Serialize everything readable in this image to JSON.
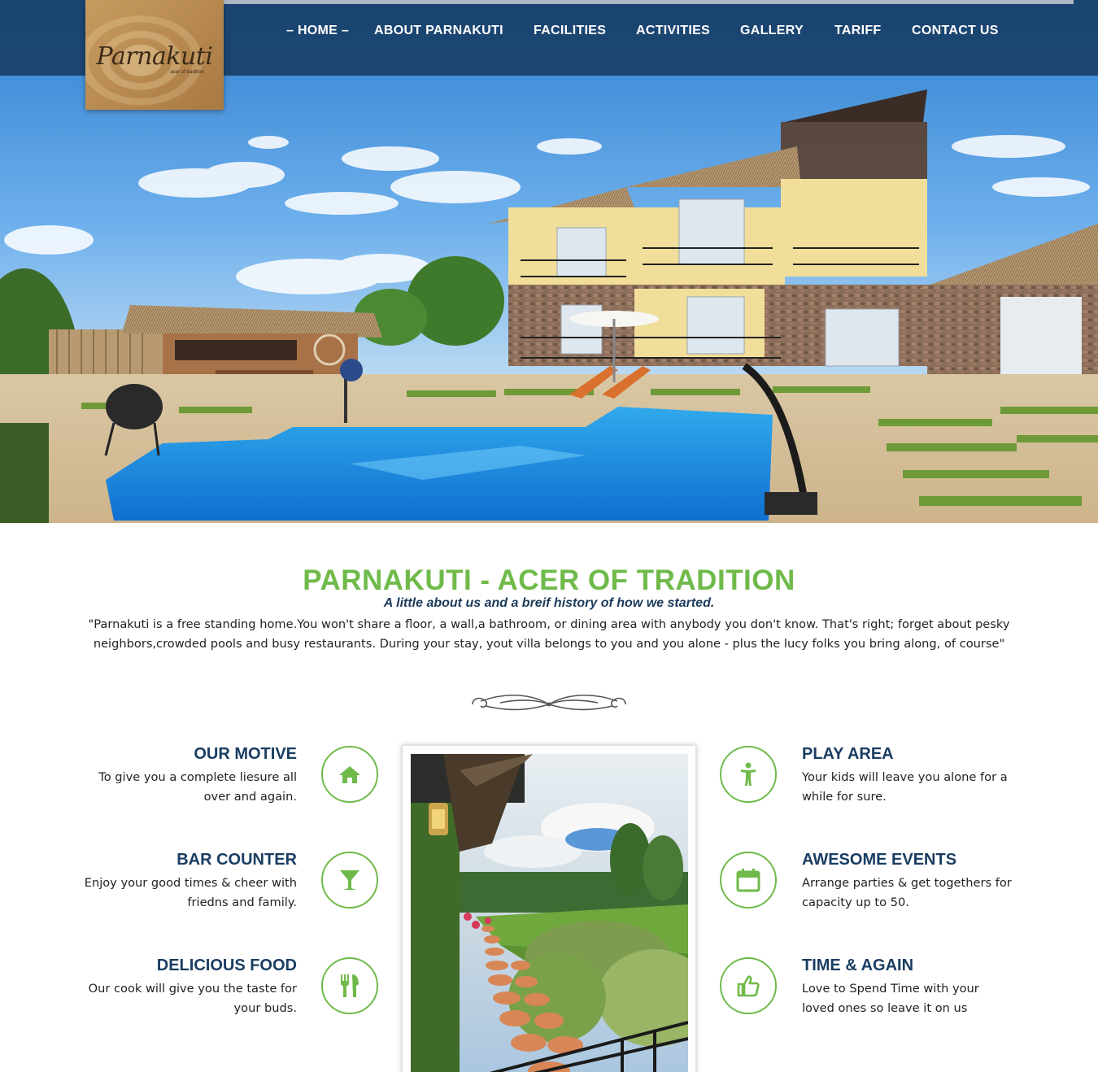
{
  "brand": {
    "logo_text": "Parnakuti",
    "logo_tagline": "acer of tradition"
  },
  "nav": {
    "items": [
      {
        "label": "– HOME –",
        "active": true
      },
      {
        "label": "ABOUT PARNAKUTI",
        "active": false
      },
      {
        "label": "FACILITIES",
        "active": false
      },
      {
        "label": "ACTIVITIES",
        "active": false
      },
      {
        "label": "GALLERY",
        "active": false
      },
      {
        "label": "TARIFF",
        "active": false
      },
      {
        "label": "CONTACT US",
        "active": false
      }
    ]
  },
  "intro": {
    "title": "PARNAKUTI - ACER OF TRADITION",
    "subtitle": "A little about us and a breif history of how we started.",
    "body": "\"Parnakuti is a free standing home.You won't share a floor, a wall,a bathroom, or dining area with anybody you don't know. That's right; forget about pesky neighbors,crowded pools and busy restaurants. During your stay, yout villa belongs to you and you alone - plus the lucy folks you bring along, of course\""
  },
  "features_left": [
    {
      "title": "OUR MOTIVE",
      "desc": "To give you a complete liesure all over and again.",
      "icon": "home-icon"
    },
    {
      "title": "BAR COUNTER",
      "desc": "Enjoy your good times & cheer with friedns and family.",
      "icon": "cocktail-icon"
    },
    {
      "title": "DELICIOUS FOOD",
      "desc": "Our cook will give you the taste for your buds.",
      "icon": "cutlery-icon"
    }
  ],
  "features_right": [
    {
      "title": "PLAY AREA",
      "desc": "Your kids will leave you alone for a while for sure.",
      "icon": "child-icon"
    },
    {
      "title": "AWESOME EVENTS",
      "desc": "Arrange parties & get togethers for capacity up to 50.",
      "icon": "calendar-icon"
    },
    {
      "title": "TIME & AGAIN",
      "desc": "Love to Spend Time with your loved ones so leave it on us",
      "icon": "thumbs-up-icon"
    }
  ],
  "colors": {
    "accent_green": "#6fba4a",
    "navy": "#1a3d62",
    "nav_bar": "#194068"
  }
}
